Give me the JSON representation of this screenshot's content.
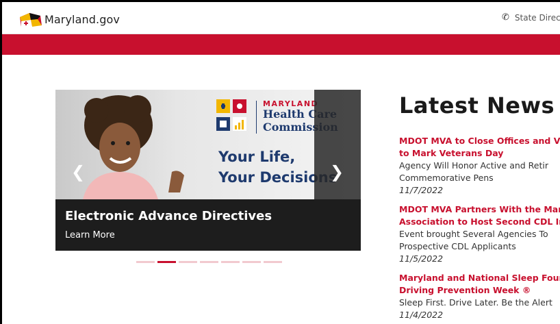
{
  "header": {
    "logo_text": "Maryland.gov",
    "state_directory": "State Direct"
  },
  "colors": {
    "brand_red": "#c8102e",
    "navy": "#1e3a6e"
  },
  "carousel": {
    "logo_md": "MARYLAND",
    "logo_line1": "Health Care",
    "logo_line2": "Commission",
    "tagline1": "Your Life,",
    "tagline2": "Your Decisions",
    "caption_title": "Electronic Advance Directives",
    "caption_link": "Learn More",
    "prev_icon": "chevron-left-icon",
    "next_icon": "chevron-right-icon",
    "prev_glyph": "❮",
    "next_glyph": "❯",
    "indicator_count": 7,
    "active_indicator": 1
  },
  "news": {
    "heading": "Latest News",
    "items": [
      {
        "title_line1": "MDOT MVA to Close Offices and V",
        "title_line2": "to Mark Veterans Day",
        "desc_line1": "Agency Will Honor Active and Retir",
        "desc_line2": "Commemorative Pens",
        "date": "11/7/2022"
      },
      {
        "title_line1": "MDOT MVA Partners With the Mar",
        "title_line2": "Association to Host Second CDL In",
        "desc_line1": "Event brought Several Agencies To",
        "desc_line2": "Prospective CDL Applicants",
        "date": "11/5/2022"
      },
      {
        "title_line1": "Maryland and National Sleep Foun",
        "title_line2": "Driving Prevention Week ®",
        "desc_line1": "Sleep First. Drive Later. Be the Alert",
        "desc_line2": "",
        "date": "11/4/2022"
      }
    ]
  }
}
